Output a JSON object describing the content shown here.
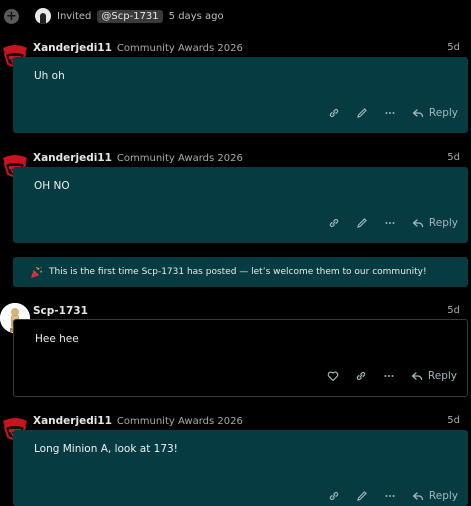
{
  "invite": {
    "verb": "Invited",
    "mention": "@Scp-1731",
    "time": "5 days ago"
  },
  "posts": [
    {
      "username": "Xanderjedi11",
      "flair": "Community Awards 2026",
      "date": "5d",
      "text": "Uh oh",
      "reply_label": "Reply"
    },
    {
      "username": "Xanderjedi11",
      "flair": "Community Awards 2026",
      "date": "5d",
      "text": "OH NO",
      "reply_label": "Reply"
    },
    {
      "username": "Scp-1731",
      "flair": "",
      "date": "5d",
      "text": "Hee hee",
      "reply_label": "Reply"
    },
    {
      "username": "Xanderjedi11",
      "flair": "Community Awards 2026",
      "date": "5d",
      "text": "Long Minion A, look at 173!",
      "reply_label": "Reply"
    }
  ],
  "welcome_banner": {
    "text": "This is the first time Scp-1731 has posted — let’s welcome them to our community!"
  },
  "colors": {
    "post_bg": "#063b41",
    "page_bg": "#000000",
    "avatar_red": "#c8141e"
  }
}
